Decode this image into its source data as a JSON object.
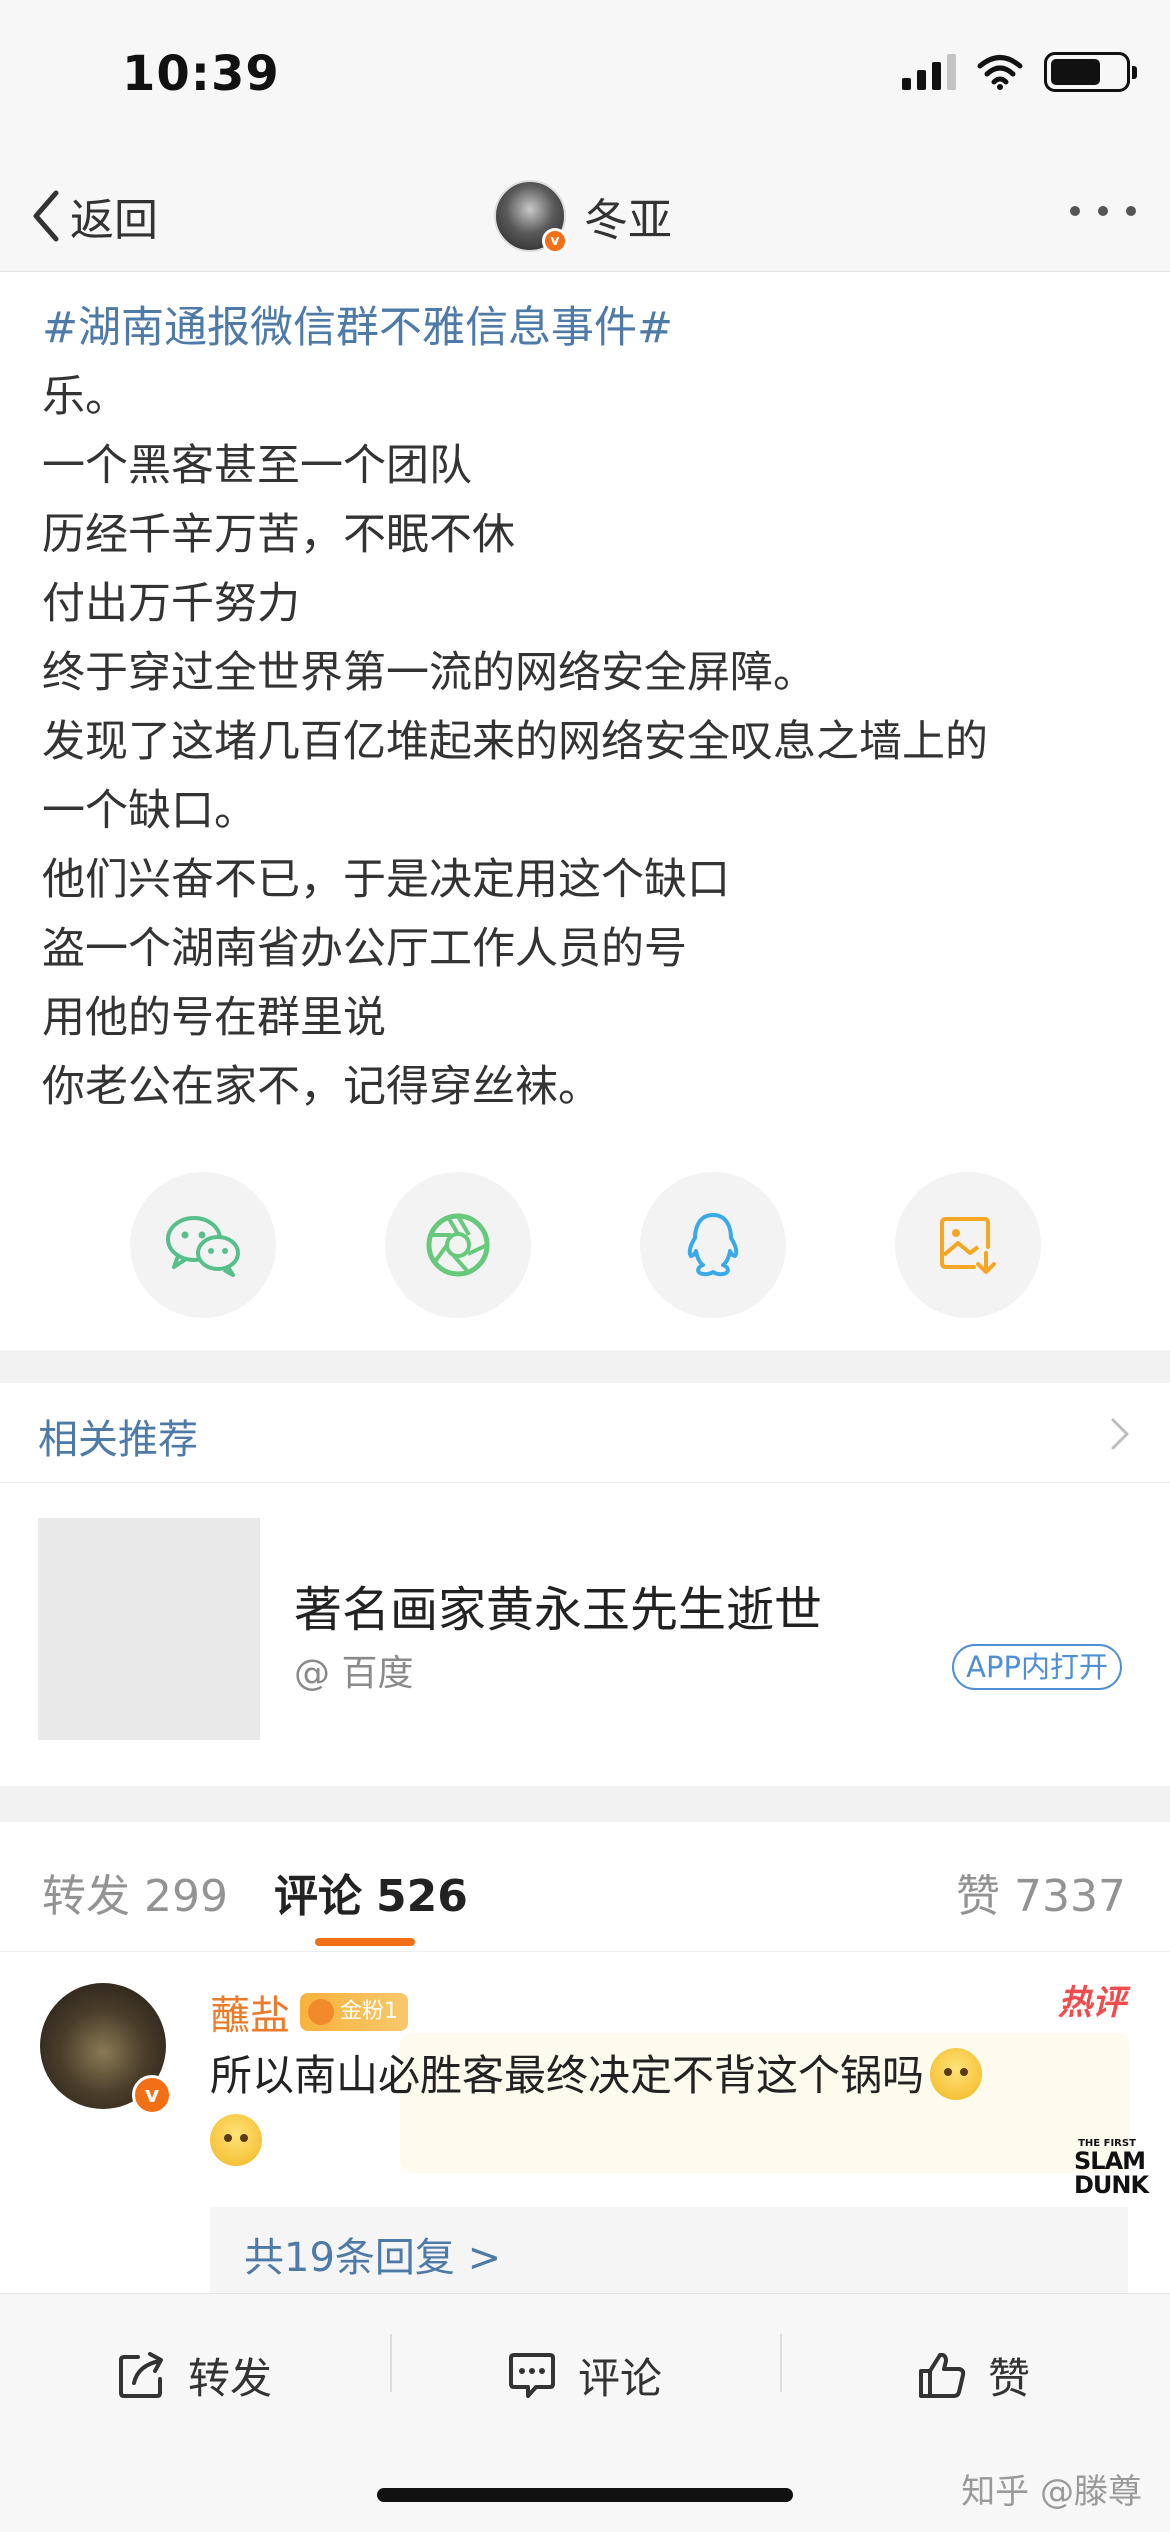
{
  "status_bar": {
    "time": "10:39"
  },
  "nav": {
    "back_label": "返回",
    "user_name": "冬亚"
  },
  "post": {
    "hashtag": "#湖南通报微信群不雅信息事件#",
    "lines": [
      "乐。",
      "一个黑客甚至一个团队",
      "历经千辛万苦，不眠不休",
      "付出万千努力",
      "终于穿过全世界第一流的网络安全屏障。",
      "发现了这堵几百亿堆起来的网络安全叹息之墙上的",
      "一个缺口。",
      "他们兴奋不已，于是决定用这个缺口",
      "盗一个湖南省办公厅工作人员的号",
      "用他的号在群里说",
      "你老公在家不，记得穿丝袜。"
    ]
  },
  "share": {
    "icons": [
      "wechat-icon",
      "moments-icon",
      "qq-icon",
      "save-image-icon"
    ],
    "colors": {
      "wechat": "#57c08a",
      "moments": "#67c97c",
      "qq": "#3aa9e8",
      "save": "#f5a623"
    }
  },
  "related": {
    "title": "相关推荐",
    "headline": "著名画家黄永玉先生逝世",
    "source": "@ 百度",
    "open_label": "APP内打开"
  },
  "tabs": {
    "repost_label": "转发",
    "repost_count": "299",
    "comment_label": "评论",
    "comment_count": "526",
    "like_label": "赞",
    "like_count": "7337"
  },
  "comment": {
    "user": "蘸盐",
    "fan_badge": "金粉1",
    "hot_tag": "热评",
    "text": "所以南山必胜客最终决定不背这个锅吗",
    "sticker_line1": "THE FIRST",
    "sticker_line2": "SLAM",
    "sticker_line3": "DUNK",
    "replies": "共19条回复 >"
  },
  "bottom_bar": {
    "repost": "转发",
    "comment": "评论",
    "like": "赞",
    "watermark": "知乎 @滕尊"
  },
  "colors": {
    "accent": "#f26f16",
    "link": "#4e7aa8",
    "background": "#f2f2f2"
  }
}
